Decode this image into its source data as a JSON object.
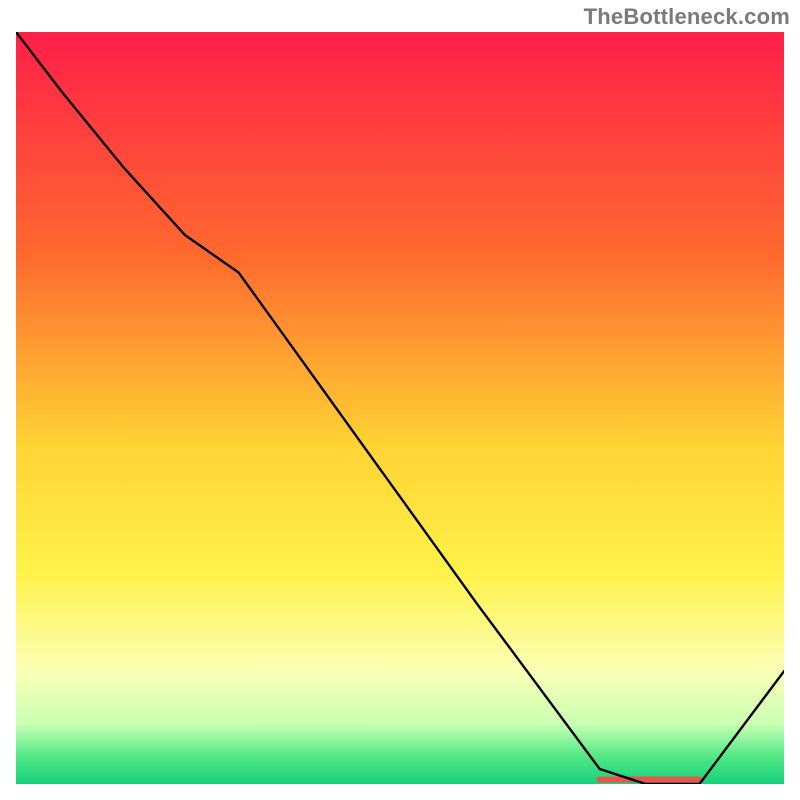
{
  "attribution": "TheBottleneck.com",
  "chart_data": {
    "type": "line",
    "title": "",
    "xlabel": "",
    "ylabel": "",
    "xlim": [
      0,
      100
    ],
    "ylim": [
      0,
      100
    ],
    "background_gradient": {
      "stops": [
        {
          "offset": 0.0,
          "color": "#ff1f49"
        },
        {
          "offset": 0.3,
          "color": "#ff6a2f"
        },
        {
          "offset": 0.55,
          "color": "#ffd333"
        },
        {
          "offset": 0.72,
          "color": "#fff24a"
        },
        {
          "offset": 0.85,
          "color": "#fbffb6"
        },
        {
          "offset": 0.92,
          "color": "#c9ffb3"
        },
        {
          "offset": 0.965,
          "color": "#4de884"
        },
        {
          "offset": 1.0,
          "color": "#18cf7c"
        }
      ]
    },
    "series": [
      {
        "name": "bottleneck-curve",
        "stroke": "#000000",
        "stroke_width": 2.4,
        "x": [
          0,
          6,
          14,
          22,
          29,
          60,
          76,
          82,
          89,
          100
        ],
        "y": [
          100,
          92,
          82,
          73,
          68,
          24,
          2,
          0,
          0,
          15
        ]
      }
    ],
    "annotations": [
      {
        "name": "optimal-band",
        "type": "segment",
        "stroke": "#e8554b",
        "stroke_width": 6,
        "x0": 76,
        "y0": 0.6,
        "x1": 89,
        "y1": 0.6
      }
    ]
  }
}
